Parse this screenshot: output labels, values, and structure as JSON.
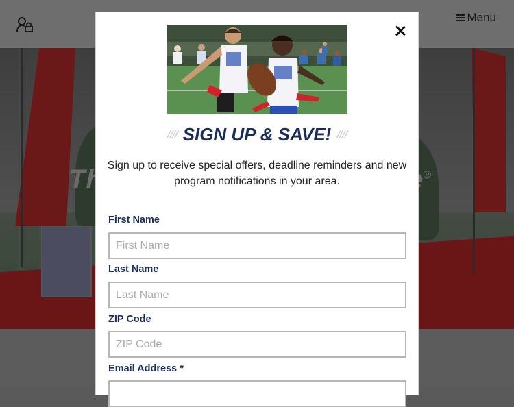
{
  "header": {
    "menu_label": "Menu",
    "menu_icon": "hamburger-icon",
    "account_icon": "user-lock-icon"
  },
  "hero": {
    "text_left": "Th",
    "text_right": "e",
    "trademark": "®"
  },
  "modal": {
    "title": "SIGN UP & SAVE!",
    "title_decoration": "////",
    "subtitle": "Sign up to receive special offers, deadline reminders and new program notifications in your area.",
    "close_icon": "close-icon",
    "fields": [
      {
        "label": "First Name",
        "placeholder": "First Name"
      },
      {
        "label": "Last Name",
        "placeholder": "Last Name"
      },
      {
        "label": "ZIP Code",
        "placeholder": "ZIP Code"
      },
      {
        "label": "Email Address *",
        "placeholder": ""
      }
    ]
  },
  "colors": {
    "heading": "#1b2d5a",
    "label": "#1b2d5a",
    "input_border": "#b5b5b5",
    "overlay": "#5a5a5a"
  }
}
